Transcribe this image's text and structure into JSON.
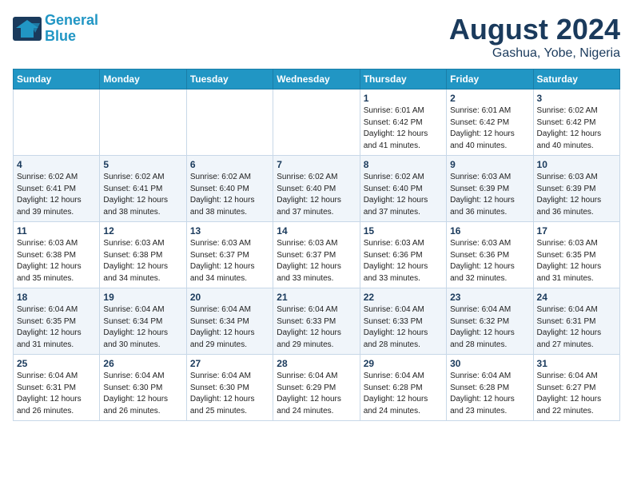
{
  "logo": {
    "line1": "General",
    "line2": "Blue"
  },
  "title": "August 2024",
  "location": "Gashua, Yobe, Nigeria",
  "days_of_week": [
    "Sunday",
    "Monday",
    "Tuesday",
    "Wednesday",
    "Thursday",
    "Friday",
    "Saturday"
  ],
  "weeks": [
    [
      {
        "day": "",
        "info": ""
      },
      {
        "day": "",
        "info": ""
      },
      {
        "day": "",
        "info": ""
      },
      {
        "day": "",
        "info": ""
      },
      {
        "day": "1",
        "info": "Sunrise: 6:01 AM\nSunset: 6:42 PM\nDaylight: 12 hours\nand 41 minutes."
      },
      {
        "day": "2",
        "info": "Sunrise: 6:01 AM\nSunset: 6:42 PM\nDaylight: 12 hours\nand 40 minutes."
      },
      {
        "day": "3",
        "info": "Sunrise: 6:02 AM\nSunset: 6:42 PM\nDaylight: 12 hours\nand 40 minutes."
      }
    ],
    [
      {
        "day": "4",
        "info": "Sunrise: 6:02 AM\nSunset: 6:41 PM\nDaylight: 12 hours\nand 39 minutes."
      },
      {
        "day": "5",
        "info": "Sunrise: 6:02 AM\nSunset: 6:41 PM\nDaylight: 12 hours\nand 38 minutes."
      },
      {
        "day": "6",
        "info": "Sunrise: 6:02 AM\nSunset: 6:40 PM\nDaylight: 12 hours\nand 38 minutes."
      },
      {
        "day": "7",
        "info": "Sunrise: 6:02 AM\nSunset: 6:40 PM\nDaylight: 12 hours\nand 37 minutes."
      },
      {
        "day": "8",
        "info": "Sunrise: 6:02 AM\nSunset: 6:40 PM\nDaylight: 12 hours\nand 37 minutes."
      },
      {
        "day": "9",
        "info": "Sunrise: 6:03 AM\nSunset: 6:39 PM\nDaylight: 12 hours\nand 36 minutes."
      },
      {
        "day": "10",
        "info": "Sunrise: 6:03 AM\nSunset: 6:39 PM\nDaylight: 12 hours\nand 36 minutes."
      }
    ],
    [
      {
        "day": "11",
        "info": "Sunrise: 6:03 AM\nSunset: 6:38 PM\nDaylight: 12 hours\nand 35 minutes."
      },
      {
        "day": "12",
        "info": "Sunrise: 6:03 AM\nSunset: 6:38 PM\nDaylight: 12 hours\nand 34 minutes."
      },
      {
        "day": "13",
        "info": "Sunrise: 6:03 AM\nSunset: 6:37 PM\nDaylight: 12 hours\nand 34 minutes."
      },
      {
        "day": "14",
        "info": "Sunrise: 6:03 AM\nSunset: 6:37 PM\nDaylight: 12 hours\nand 33 minutes."
      },
      {
        "day": "15",
        "info": "Sunrise: 6:03 AM\nSunset: 6:36 PM\nDaylight: 12 hours\nand 33 minutes."
      },
      {
        "day": "16",
        "info": "Sunrise: 6:03 AM\nSunset: 6:36 PM\nDaylight: 12 hours\nand 32 minutes."
      },
      {
        "day": "17",
        "info": "Sunrise: 6:03 AM\nSunset: 6:35 PM\nDaylight: 12 hours\nand 31 minutes."
      }
    ],
    [
      {
        "day": "18",
        "info": "Sunrise: 6:04 AM\nSunset: 6:35 PM\nDaylight: 12 hours\nand 31 minutes."
      },
      {
        "day": "19",
        "info": "Sunrise: 6:04 AM\nSunset: 6:34 PM\nDaylight: 12 hours\nand 30 minutes."
      },
      {
        "day": "20",
        "info": "Sunrise: 6:04 AM\nSunset: 6:34 PM\nDaylight: 12 hours\nand 29 minutes."
      },
      {
        "day": "21",
        "info": "Sunrise: 6:04 AM\nSunset: 6:33 PM\nDaylight: 12 hours\nand 29 minutes."
      },
      {
        "day": "22",
        "info": "Sunrise: 6:04 AM\nSunset: 6:33 PM\nDaylight: 12 hours\nand 28 minutes."
      },
      {
        "day": "23",
        "info": "Sunrise: 6:04 AM\nSunset: 6:32 PM\nDaylight: 12 hours\nand 28 minutes."
      },
      {
        "day": "24",
        "info": "Sunrise: 6:04 AM\nSunset: 6:31 PM\nDaylight: 12 hours\nand 27 minutes."
      }
    ],
    [
      {
        "day": "25",
        "info": "Sunrise: 6:04 AM\nSunset: 6:31 PM\nDaylight: 12 hours\nand 26 minutes."
      },
      {
        "day": "26",
        "info": "Sunrise: 6:04 AM\nSunset: 6:30 PM\nDaylight: 12 hours\nand 26 minutes."
      },
      {
        "day": "27",
        "info": "Sunrise: 6:04 AM\nSunset: 6:30 PM\nDaylight: 12 hours\nand 25 minutes."
      },
      {
        "day": "28",
        "info": "Sunrise: 6:04 AM\nSunset: 6:29 PM\nDaylight: 12 hours\nand 24 minutes."
      },
      {
        "day": "29",
        "info": "Sunrise: 6:04 AM\nSunset: 6:28 PM\nDaylight: 12 hours\nand 24 minutes."
      },
      {
        "day": "30",
        "info": "Sunrise: 6:04 AM\nSunset: 6:28 PM\nDaylight: 12 hours\nand 23 minutes."
      },
      {
        "day": "31",
        "info": "Sunrise: 6:04 AM\nSunset: 6:27 PM\nDaylight: 12 hours\nand 22 minutes."
      }
    ]
  ]
}
